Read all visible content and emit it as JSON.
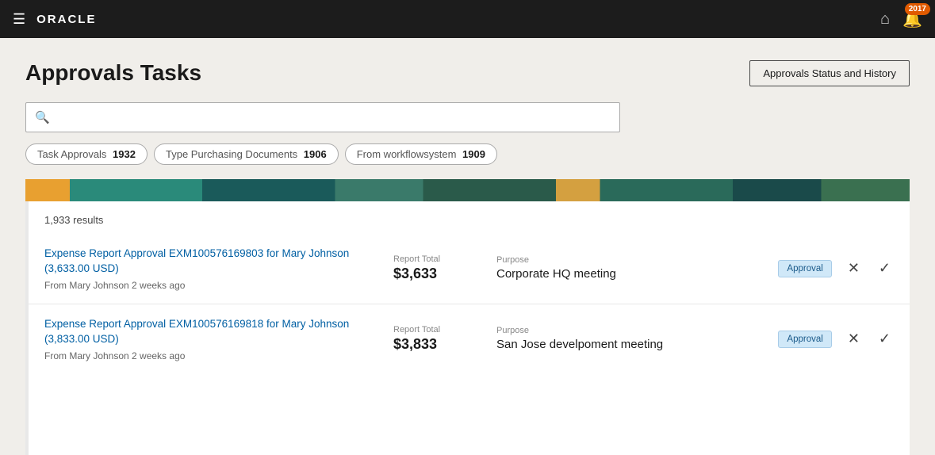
{
  "topnav": {
    "logo": "ORACLE",
    "notif_badge": "2017"
  },
  "page": {
    "title": "Approvals Tasks",
    "approvals_status_btn": "Approvals Status and History"
  },
  "search": {
    "placeholder": ""
  },
  "filters": [
    {
      "label": "Task Approvals",
      "value": "1932"
    },
    {
      "label": "Type Purchasing Documents",
      "value": "1906"
    },
    {
      "label": "From workflowsystem",
      "value": "1909"
    }
  ],
  "results": {
    "count": "1,933 results",
    "items": [
      {
        "title": "Expense Report Approval EXM100576169803 for Mary Johnson (3,633.00 USD)",
        "subtitle": "From Mary Johnson 2 weeks ago",
        "amount_label": "Report Total",
        "amount_value": "$3,633",
        "purpose_label": "Purpose",
        "purpose_value": "Corporate HQ meeting",
        "badge": "Approval"
      },
      {
        "title": "Expense Report Approval EXM100576169818 for Mary Johnson (3,833.00 USD)",
        "subtitle": "From Mary Johnson 2 weeks ago",
        "amount_label": "Report Total",
        "amount_value": "$3,833",
        "purpose_label": "Purpose",
        "purpose_value": "San Jose develpoment meeting",
        "badge": "Approval"
      }
    ]
  }
}
